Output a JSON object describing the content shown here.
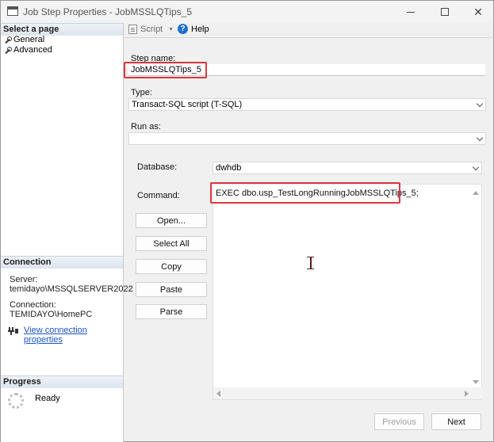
{
  "window": {
    "title": "Job Step Properties - JobMSSLQTips_5",
    "minimize_icon": "minimize-icon",
    "maximize_icon": "maximize-icon",
    "close_icon": "close-icon"
  },
  "left_panel": {
    "select_page_header": "Select a page",
    "pages": [
      {
        "label": "General",
        "icon": "wrench-icon"
      },
      {
        "label": "Advanced",
        "icon": "wrench-icon"
      }
    ],
    "connection_header": "Connection",
    "server_label": "Server:",
    "server_value": "temidayo\\MSSQLSERVER2022",
    "connection_label": "Connection:",
    "connection_value": "TEMIDAYO\\HomePC",
    "view_link": "View connection properties",
    "progress_header": "Progress",
    "progress_status": "Ready"
  },
  "toolbar": {
    "script_label": "Script",
    "help_label": "Help"
  },
  "form": {
    "step_name_label": "Step name:",
    "step_name_value": "JobMSSLQTips_5",
    "type_label": "Type:",
    "type_value": "Transact-SQL script (T-SQL)",
    "run_as_label": "Run as:",
    "run_as_value": "",
    "database_label": "Database:",
    "database_value": "dwhdb",
    "command_label": "Command:",
    "command_value": "EXEC dbo.usp_TestLongRunningJobMSSLQTips_5;",
    "buttons": {
      "open": "Open...",
      "select_all": "Select All",
      "copy": "Copy",
      "paste": "Paste",
      "parse": "Parse"
    }
  },
  "footer": {
    "previous": "Previous",
    "next": "Next"
  },
  "colors": {
    "highlight_box": "#d8383f",
    "link": "#1a55c6",
    "help_icon": "#1f6fd1"
  }
}
